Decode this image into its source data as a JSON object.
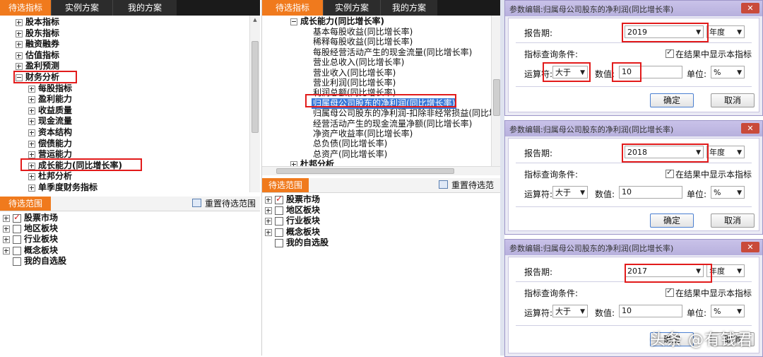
{
  "panel1": {
    "tabs": [
      "待选指标",
      "实例方案",
      "我的方案"
    ],
    "tree": [
      {
        "label": "股本指标",
        "expand": "plus",
        "level": 0
      },
      {
        "label": "股东指标",
        "expand": "plus",
        "level": 0
      },
      {
        "label": "融资融券",
        "expand": "plus",
        "level": 0
      },
      {
        "label": "估值指标",
        "expand": "plus",
        "level": 0
      },
      {
        "label": "盈利预测",
        "expand": "plus",
        "level": 0
      },
      {
        "label": "财务分析",
        "expand": "minus",
        "level": 0
      },
      {
        "label": "每股指标",
        "expand": "plus",
        "level": 1
      },
      {
        "label": "盈利能力",
        "expand": "plus",
        "level": 1
      },
      {
        "label": "收益质量",
        "expand": "plus",
        "level": 1
      },
      {
        "label": "现金流量",
        "expand": "plus",
        "level": 1
      },
      {
        "label": "资本结构",
        "expand": "plus",
        "level": 1
      },
      {
        "label": "偿债能力",
        "expand": "plus",
        "level": 1
      },
      {
        "label": "营运能力",
        "expand": "plus",
        "level": 1
      },
      {
        "label": "成长能力(同比增长率)",
        "expand": "plus",
        "level": 1
      },
      {
        "label": "杜邦分析",
        "expand": "plus",
        "level": 1
      },
      {
        "label": "单季度财务指标",
        "expand": "plus",
        "level": 1
      }
    ],
    "range_tab": "待选范围",
    "reset_label": "重置待选范围",
    "range_items": [
      {
        "label": "股票市场",
        "checked": true,
        "expand": true
      },
      {
        "label": "地区板块",
        "checked": false,
        "expand": true
      },
      {
        "label": "行业板块",
        "checked": false,
        "expand": true
      },
      {
        "label": "概念板块",
        "checked": false,
        "expand": true
      },
      {
        "label": "我的自选股",
        "checked": false,
        "expand": false
      }
    ]
  },
  "panel2": {
    "tabs": [
      "待选指标",
      "实例方案",
      "我的方案"
    ],
    "header_node": "成长能力(同比增长率)",
    "tree": [
      "基本每股收益(同比增长率)",
      "稀释每股收益(同比增长率)",
      "每股经营活动产生的现金流量(同比增长率)",
      "营业总收入(同比增长率)",
      "营业收入(同比增长率)",
      "营业利润(同比增长率)",
      "利润总额(同比增长率)",
      "归属母公司股东的净利润(同比增长率)",
      "归属母公司股东的净利润-扣除非经常损益(同比增",
      "经营活动产生的现金流量净额(同比增长率)",
      "净资产收益率(同比增长率)",
      "总负债(同比增长率)",
      "总资产(同比增长率)"
    ],
    "footer_node": "杜邦分析",
    "range_tab": "待选范围",
    "reset_label": "重置待选范围",
    "range_items": [
      {
        "label": "股票市场",
        "checked": true,
        "expand": true
      },
      {
        "label": "地区板块",
        "checked": false,
        "expand": true
      },
      {
        "label": "行业板块",
        "checked": false,
        "expand": true
      },
      {
        "label": "概念板块",
        "checked": false,
        "expand": true
      },
      {
        "label": "我的自选股",
        "checked": false,
        "expand": false
      }
    ]
  },
  "dialogs": [
    {
      "title": "参数编辑:归属母公司股东的净利润(同比增长率)",
      "period_label": "报告期:",
      "year": "2019",
      "period_type": "年度",
      "cond_label": "指标查询条件:",
      "show_label": "在结果中显示本指标",
      "op_label": "运算符:",
      "op": "大于",
      "value_label": "数值:",
      "value": "10",
      "unit_label": "单位:",
      "unit": "%",
      "ok": "确定",
      "cancel": "取消"
    },
    {
      "title": "参数编辑:归属母公司股东的净利润(同比增长率)",
      "period_label": "报告期:",
      "year": "2018",
      "period_type": "年度",
      "cond_label": "指标查询条件:",
      "show_label": "在结果中显示本指标",
      "op_label": "运算符:",
      "op": "大于",
      "value_label": "数值:",
      "value": "10",
      "unit_label": "单位:",
      "unit": "%",
      "ok": "确定",
      "cancel": "取消"
    },
    {
      "title": "参数编辑:归属母公司股东的净利润(同比增长率)",
      "period_label": "报告期:",
      "year": "2017",
      "period_type": "年度",
      "cond_label": "指标查询条件:",
      "show_label": "在结果中显示本指标",
      "op_label": "运算符:",
      "op": "大于",
      "value_label": "数值:",
      "value": "10",
      "unit_label": "单位:",
      "unit": "%",
      "ok": "确定",
      "cancel": "取消"
    }
  ],
  "watermark": "头条 @有钱君",
  "colors": {
    "accent": "#f07a1d",
    "highlight": "#e21b1b",
    "selection": "#3a78d8",
    "dialog_title": "#bdb6e0"
  }
}
